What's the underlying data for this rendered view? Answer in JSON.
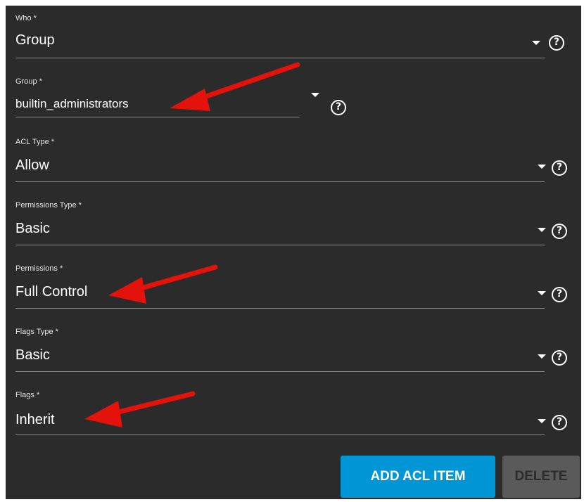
{
  "fields": [
    {
      "label": "Who *",
      "value": "Group",
      "help": "?"
    },
    {
      "label": "Group *",
      "value": "builtin_administrators",
      "help": "?"
    },
    {
      "label": "ACL Type *",
      "value": "Allow",
      "help": "?"
    },
    {
      "label": "Permissions Type *",
      "value": "Basic",
      "help": "?"
    },
    {
      "label": "Permissions *",
      "value": "Full Control",
      "help": "?"
    },
    {
      "label": "Flags Type *",
      "value": "Basic",
      "help": "?"
    },
    {
      "label": "Flags *",
      "value": "Inherit",
      "help": "?"
    }
  ],
  "buttons": {
    "add_label": "ADD ACL ITEM",
    "delete_label": "DELETE"
  },
  "colors": {
    "panel_bg": "#2b2b2b",
    "primary": "#0095d5",
    "disabled": "#5a5a5a",
    "arrow": "#e3120b"
  },
  "icons": {
    "dropdown": "caret-down-icon",
    "help": "help-circle-icon",
    "annotation": "red-arrow-icon"
  }
}
